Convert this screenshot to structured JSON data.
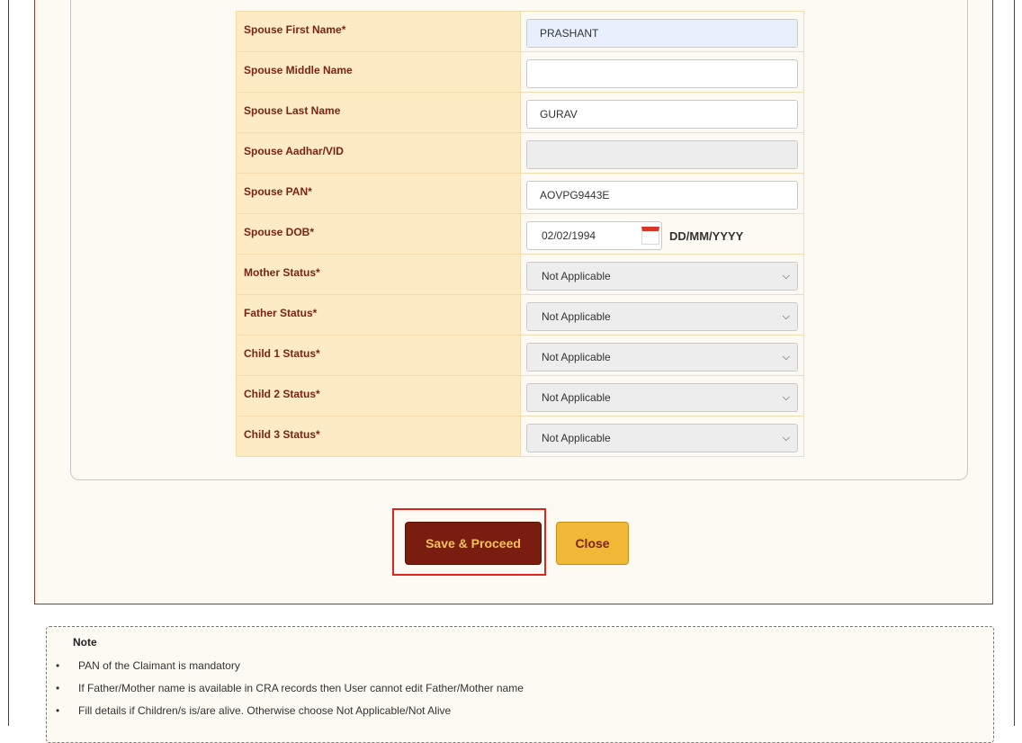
{
  "form": {
    "rows": [
      {
        "label": "Spouse First Name*",
        "type": "text",
        "value": "PRASHANT",
        "state": "autofilled"
      },
      {
        "label": "Spouse Middle Name",
        "type": "text",
        "value": "",
        "state": "normal"
      },
      {
        "label": "Spouse Last Name",
        "type": "text",
        "value": "GURAV",
        "state": "normal"
      },
      {
        "label": "Spouse Aadhar/VID",
        "type": "text",
        "value": "",
        "state": "disabled"
      },
      {
        "label": "Spouse PAN*",
        "type": "text",
        "value": "AOVPG9443E",
        "state": "normal"
      },
      {
        "label": "Spouse DOB*",
        "type": "date",
        "value": "02/02/1994",
        "hint": "DD/MM/YYYY"
      },
      {
        "label": "Mother Status*",
        "type": "select",
        "value": "Not Applicable"
      },
      {
        "label": "Father Status*",
        "type": "select",
        "value": "Not Applicable"
      },
      {
        "label": "Child 1 Status*",
        "type": "select",
        "value": "Not Applicable"
      },
      {
        "label": "Child 2 Status*",
        "type": "select",
        "value": "Not Applicable"
      },
      {
        "label": "Child 3 Status*",
        "type": "select",
        "value": "Not Applicable"
      }
    ]
  },
  "actions": {
    "save_label": "Save & Proceed",
    "close_label": "Close"
  },
  "note": {
    "title": "Note",
    "items": [
      "PAN of the Claimant is mandatory",
      "If Father/Mother name is available in CRA records then User cannot edit Father/Mother name",
      "Fill details if Children/s is/are alive. Otherwise choose Not Applicable/Not Alive"
    ]
  },
  "colors": {
    "label_bg": "#fcebc3",
    "label_text": "#7a2414",
    "save_bg": "#7a1d10",
    "close_bg": "#f0b836",
    "highlight": "#e0241b"
  }
}
